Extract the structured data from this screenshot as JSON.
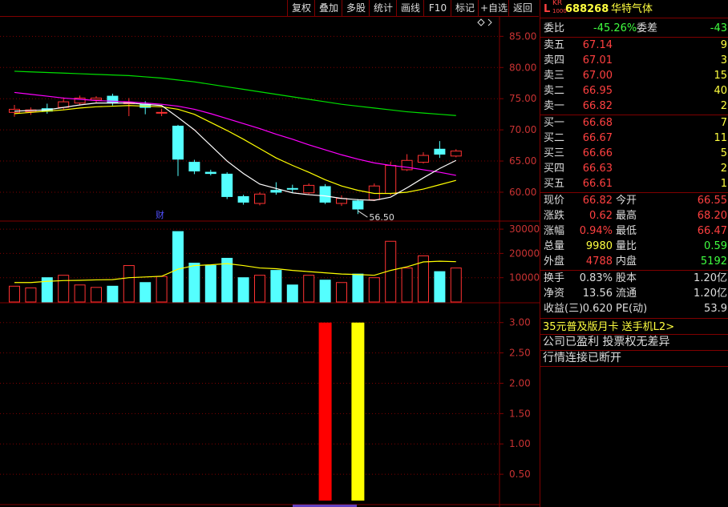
{
  "toolbar": {
    "buttons": [
      "复权",
      "叠加",
      "多股",
      "统计",
      "画线",
      "F10",
      "标记",
      "+自选",
      "返回"
    ]
  },
  "price_axis": [
    "85.00",
    "80.00",
    "75.00",
    "70.00",
    "65.00",
    "60.00"
  ],
  "volume_axis": [
    "30000",
    "20000",
    "10000"
  ],
  "indicator_axis": [
    "3.00",
    "2.50",
    "2.00",
    "1.50",
    "1.00",
    "0.50"
  ],
  "low_annotation": "56.50",
  "event_marker": "财",
  "chart_data": {
    "type": "candlestick",
    "candles": [
      {
        "o": 72.8,
        "c": 73.3,
        "h": 74.0,
        "l": 72.1,
        "v": 6500
      },
      {
        "o": 72.9,
        "c": 73.2,
        "h": 73.6,
        "l": 72.4,
        "v": 5800
      },
      {
        "o": 73.4,
        "c": 73.0,
        "h": 74.2,
        "l": 72.6,
        "v": 10000
      },
      {
        "o": 73.6,
        "c": 74.5,
        "h": 75.2,
        "l": 73.2,
        "v": 11000
      },
      {
        "o": 74.3,
        "c": 75.1,
        "h": 75.5,
        "l": 73.9,
        "v": 7000
      },
      {
        "o": 74.8,
        "c": 75.1,
        "h": 75.4,
        "l": 74.4,
        "v": 6000
      },
      {
        "o": 75.4,
        "c": 74.3,
        "h": 75.8,
        "l": 73.9,
        "v": 6500
      },
      {
        "o": 74.2,
        "c": 74.4,
        "h": 75.1,
        "l": 72.2,
        "v": 15000
      },
      {
        "o": 74.1,
        "c": 73.6,
        "h": 74.6,
        "l": 72.5,
        "v": 8000
      },
      {
        "o": 72.8,
        "c": 72.8,
        "h": 73.4,
        "l": 72.2,
        "v": 10500
      },
      {
        "o": 70.6,
        "c": 65.3,
        "h": 70.8,
        "l": 62.6,
        "v": 29000
      },
      {
        "o": 64.8,
        "c": 63.4,
        "h": 65.2,
        "l": 62.9,
        "v": 16000
      },
      {
        "o": 63.2,
        "c": 63.0,
        "h": 63.6,
        "l": 62.7,
        "v": 15000
      },
      {
        "o": 62.9,
        "c": 59.3,
        "h": 63.2,
        "l": 58.9,
        "v": 18000
      },
      {
        "o": 59.3,
        "c": 58.4,
        "h": 59.6,
        "l": 58.0,
        "v": 10000
      },
      {
        "o": 58.2,
        "c": 59.7,
        "h": 60.0,
        "l": 57.9,
        "v": 11000
      },
      {
        "o": 60.3,
        "c": 60.0,
        "h": 61.6,
        "l": 59.6,
        "v": 13000
      },
      {
        "o": 60.6,
        "c": 60.5,
        "h": 61.2,
        "l": 59.9,
        "v": 7000
      },
      {
        "o": 59.9,
        "c": 61.1,
        "h": 61.4,
        "l": 59.6,
        "v": 11000
      },
      {
        "o": 60.9,
        "c": 58.4,
        "h": 61.3,
        "l": 58.1,
        "v": 9000
      },
      {
        "o": 58.2,
        "c": 59.0,
        "h": 59.5,
        "l": 57.8,
        "v": 8000
      },
      {
        "o": 58.6,
        "c": 57.3,
        "h": 58.9,
        "l": 56.5,
        "v": 11500
      },
      {
        "o": 58.8,
        "c": 61.0,
        "h": 61.4,
        "l": 58.6,
        "v": 10000
      },
      {
        "o": 59.8,
        "c": 64.3,
        "h": 64.9,
        "l": 59.5,
        "v": 25000
      },
      {
        "o": 63.6,
        "c": 65.1,
        "h": 66.1,
        "l": 63.4,
        "v": 14000
      },
      {
        "o": 64.8,
        "c": 65.9,
        "h": 66.4,
        "l": 64.6,
        "v": 19000
      },
      {
        "o": 66.9,
        "c": 66.1,
        "h": 68.2,
        "l": 65.5,
        "v": 12500
      },
      {
        "o": 65.8,
        "c": 66.6,
        "h": 66.9,
        "l": 65.6,
        "v": 14000
      }
    ],
    "ma_short": [
      73.0,
      73.1,
      73.2,
      73.6,
      74.0,
      74.3,
      74.3,
      74.3,
      74.1,
      73.9,
      72.0,
      70.0,
      67.5,
      65.0,
      63.0,
      61.3,
      60.6,
      59.9,
      59.6,
      59.4,
      59.0,
      58.8,
      58.7,
      59.2,
      60.7,
      62.3,
      63.8,
      65.1
    ],
    "ma_mid": [
      72.6,
      72.8,
      73.0,
      73.2,
      73.5,
      73.7,
      73.8,
      73.9,
      73.8,
      73.7,
      73.3,
      72.5,
      71.2,
      69.9,
      68.5,
      67.0,
      65.5,
      64.3,
      63.2,
      62.0,
      61.0,
      60.3,
      59.8,
      59.8,
      60.0,
      60.5,
      61.2,
      61.9
    ],
    "ma_long": [
      76.0,
      75.7,
      75.4,
      75.1,
      74.9,
      74.7,
      74.6,
      74.5,
      74.3,
      74.1,
      73.8,
      73.3,
      72.6,
      71.8,
      71.0,
      70.2,
      69.3,
      68.5,
      67.6,
      66.8,
      66.0,
      65.3,
      64.7,
      64.3,
      64.0,
      63.6,
      63.2,
      62.7
    ],
    "ma_longer": [
      79.4,
      79.3,
      79.2,
      79.1,
      79.0,
      78.9,
      78.8,
      78.7,
      78.5,
      78.3,
      78.0,
      77.7,
      77.3,
      76.9,
      76.5,
      76.1,
      75.7,
      75.3,
      74.9,
      74.5,
      74.1,
      73.8,
      73.5,
      73.2,
      72.9,
      72.7,
      72.5,
      72.3
    ],
    "vol_ma": [
      8000,
      8000,
      8500,
      8800,
      8900,
      9100,
      9200,
      10000,
      10300,
      10600,
      13500,
      15000,
      15300,
      15800,
      15000,
      14000,
      13700,
      13000,
      12500,
      12000,
      11500,
      11300,
      11000,
      13000,
      14500,
      16500,
      16800,
      16600
    ],
    "indicator_bars": [
      {
        "index": 19,
        "value": 3.0,
        "color": "#ff0000"
      },
      {
        "index": 21,
        "value": 3.0,
        "color": "#ffff00"
      }
    ],
    "price_range": [
      55.5,
      88
    ],
    "volume_range": [
      0,
      33000
    ],
    "indicator_range": [
      0,
      3.3
    ]
  },
  "quote": {
    "stock_code": "688268",
    "stock_name": "华特气体",
    "badge_top": "KR",
    "badge_bottom": "1000",
    "badge_l": "L",
    "weibi_label": "委比",
    "weibi_value": "-45.26%",
    "weicha_label": "委差",
    "weicha_value": "-43",
    "asks": [
      {
        "label": "卖五",
        "price": "67.14",
        "vol": "9"
      },
      {
        "label": "卖四",
        "price": "67.01",
        "vol": "3"
      },
      {
        "label": "卖三",
        "price": "67.00",
        "vol": "15"
      },
      {
        "label": "卖二",
        "price": "66.95",
        "vol": "40"
      },
      {
        "label": "卖一",
        "price": "66.82",
        "vol": "2"
      }
    ],
    "bids": [
      {
        "label": "买一",
        "price": "66.68",
        "vol": "7"
      },
      {
        "label": "买二",
        "price": "66.67",
        "vol": "11"
      },
      {
        "label": "买三",
        "price": "66.66",
        "vol": "5"
      },
      {
        "label": "买四",
        "price": "66.63",
        "vol": "2"
      },
      {
        "label": "买五",
        "price": "66.61",
        "vol": "1"
      }
    ],
    "stats": [
      {
        "l1": "现价",
        "v1": "66.82",
        "c1": "#ff4040",
        "l2": "今开",
        "v2": "66.55",
        "c2": "#ff4040"
      },
      {
        "l1": "涨跌",
        "v1": "0.62",
        "c1": "#ff4040",
        "l2": "最高",
        "v2": "68.20",
        "c2": "#ff4040"
      },
      {
        "l1": "涨幅",
        "v1": "0.94%",
        "c1": "#ff4040",
        "l2": "最低",
        "v2": "66.47",
        "c2": "#ff4040"
      },
      {
        "l1": "总量",
        "v1": "9980",
        "c1": "#ffff40",
        "l2": "量比",
        "v2": "0.59",
        "c2": "#40ff40"
      },
      {
        "l1": "外盘",
        "v1": "4788",
        "c1": "#ff4040",
        "l2": "内盘",
        "v2": "5192",
        "c2": "#40ff40"
      }
    ],
    "stats2": [
      {
        "l1": "换手",
        "v1": "0.83%",
        "l2": "股本",
        "v2": "1.20亿"
      },
      {
        "l1": "净资",
        "v1": "13.56",
        "l2": "流通",
        "v2": "1.20亿"
      },
      {
        "l1": "收益(三)",
        "v1": "0.620",
        "l2": "PE(动)",
        "v2": "53.9"
      }
    ],
    "promo": "35元普及版月卡 送手机L2>",
    "notice1": "公司已盈利 投票权无差异",
    "notice2": "行情连接已断开"
  },
  "colors": {
    "up": "#ff3232",
    "down": "#54ffff",
    "ma_short": "#ffffff",
    "ma_mid": "#ffff00",
    "ma_long": "#ff00ff",
    "ma_longer": "#00e000",
    "grid": "#800000",
    "axis_text": "#c83232"
  }
}
